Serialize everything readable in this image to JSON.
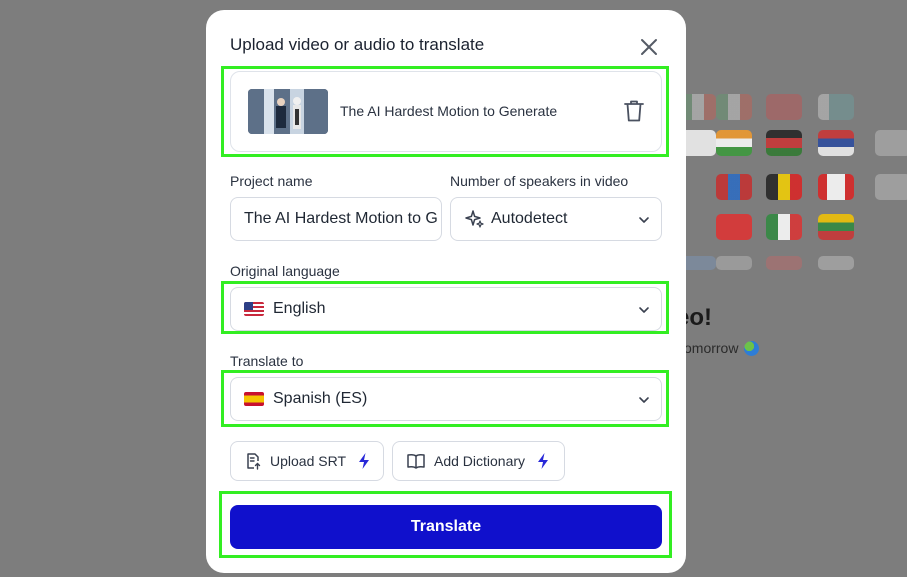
{
  "background": {
    "heading_partial": "eo!",
    "subtext_partial": "omorrow",
    "globe_icon": "globe-icon"
  },
  "modal": {
    "title": "Upload video or audio to translate",
    "close_icon": "close-icon",
    "file": {
      "name": "The AI Hardest Motion to Generate",
      "delete_icon": "trash-icon"
    },
    "project_name": {
      "label": "Project name",
      "value": "The AI Hardest Motion to G"
    },
    "speakers": {
      "label": "Number of speakers in video",
      "value": "Autodetect",
      "icon": "sparkle-icon"
    },
    "original_language": {
      "label": "Original language",
      "value": "English",
      "flag": "us-flag-icon"
    },
    "translate_to": {
      "label": "Translate to",
      "value": "Spanish (ES)",
      "flag": "spain-flag-icon"
    },
    "upload_srt": {
      "label": "Upload SRT",
      "icon": "file-upload-icon",
      "badge_icon": "lightning-icon"
    },
    "add_dictionary": {
      "label": "Add Dictionary",
      "icon": "book-icon",
      "badge_icon": "lightning-icon"
    },
    "translate_button": "Translate"
  },
  "colors": {
    "accent": "#1010cc",
    "highlight": "#33ee22",
    "overlay": "#7b7b7b",
    "lightning": "#2828d8"
  }
}
